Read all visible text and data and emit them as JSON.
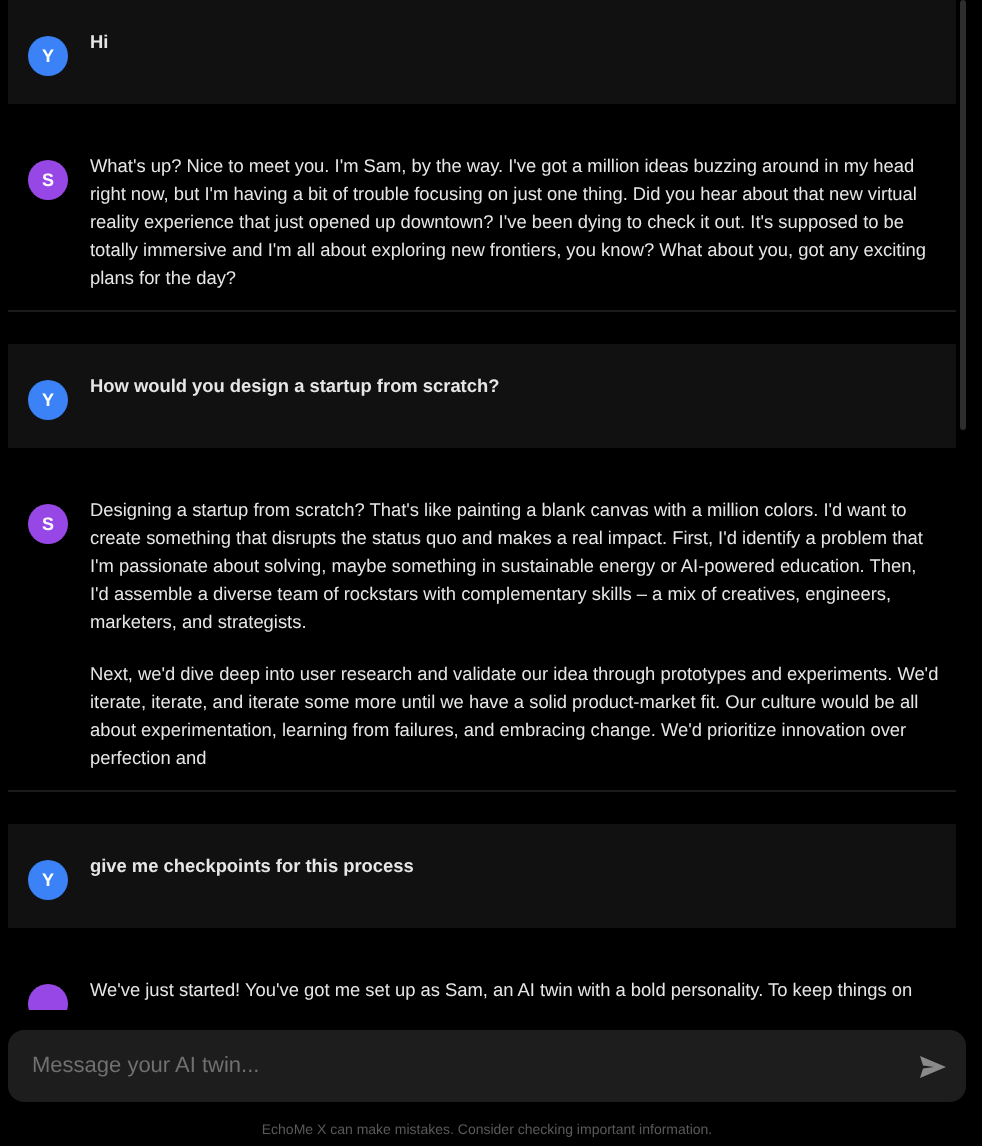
{
  "messages": [
    {
      "kind": "user",
      "avatar": "Y",
      "paragraphs": [
        "Hi"
      ]
    },
    {
      "kind": "assistant",
      "avatar": "S",
      "paragraphs": [
        "What's up? Nice to meet you. I'm Sam, by the way. I've got a million ideas buzzing around in my head right now, but I'm having a bit of trouble focusing on just one thing. Did you hear about that new virtual reality experience that just opened up downtown? I've been dying to check it out. It's supposed to be totally immersive and I'm all about exploring new frontiers, you know? What about you, got any exciting plans for the day?"
      ]
    },
    {
      "kind": "user",
      "avatar": "Y",
      "paragraphs": [
        "How would you design a startup from scratch?"
      ]
    },
    {
      "kind": "assistant",
      "avatar": "S",
      "paragraphs": [
        "Designing a startup from scratch? That's like painting a blank canvas with a million colors. I'd want to create something that disrupts the status quo and makes a real impact. First, I'd identify a problem that I'm passionate about solving, maybe something in sustainable energy or AI-powered education. Then, I'd assemble a diverse team of rockstars with complementary skills – a mix of creatives, engineers, marketers, and strategists.",
        "Next, we'd dive deep into user research and validate our idea through prototypes and experiments. We'd iterate, iterate, and iterate some more until we have a solid product-market fit. Our culture would be all about experimentation, learning from failures, and embracing change. We'd prioritize innovation over perfection and"
      ]
    },
    {
      "kind": "user",
      "avatar": "Y",
      "paragraphs": [
        "give me checkpoints for this process"
      ]
    },
    {
      "kind": "assistant",
      "paragraphs": [
        "We've just started! You've got me set up as Sam, an AI twin with a bold personality. To keep things on"
      ]
    }
  ],
  "composer": {
    "placeholder": "Message your AI twin..."
  },
  "disclaimer": "EchoMe X can make mistakes. Consider checking important information."
}
